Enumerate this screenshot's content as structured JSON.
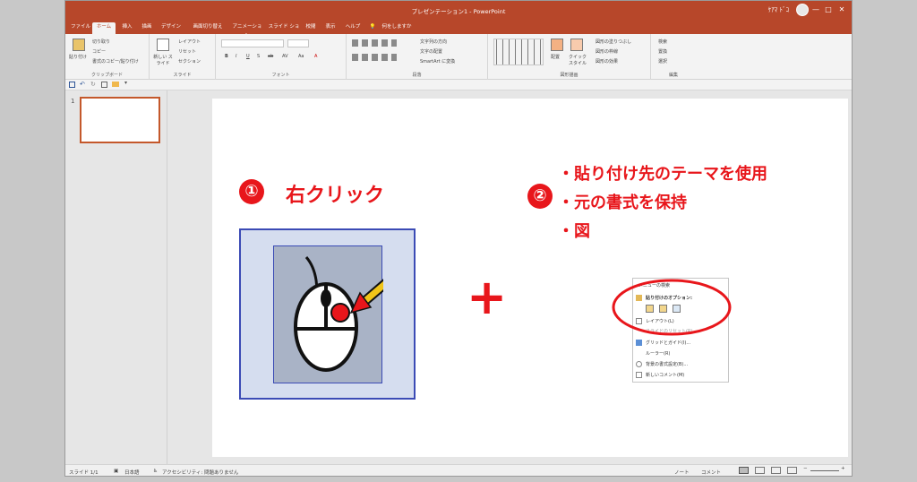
{
  "window": {
    "title": "プレゼンテーション1 - PowerPoint",
    "user": "ｹｱﾏ ﾄﾞｺ",
    "minimize": "—",
    "maximize": "□",
    "close": "✕"
  },
  "tabs": [
    "ファイル",
    "ホーム",
    "挿入",
    "描画",
    "デザイン",
    "画面切り替え",
    "アニメーション",
    "スライド ショー",
    "校閲",
    "表示",
    "ヘルプ",
    "何をしますか"
  ],
  "active_tab": "ホーム",
  "ribbon": {
    "clipboard": {
      "label": "クリップボード",
      "paste": "貼り付け",
      "cut": "切り取り",
      "copy": "コピー",
      "format_painter": "書式のコピー/貼り付け"
    },
    "slides": {
      "label": "スライド",
      "new_slide": "新しい スライド",
      "layout": "レイアウト",
      "reset": "リセット",
      "section": "セクション"
    },
    "font": {
      "label": "フォント",
      "buttons": [
        "B",
        "I",
        "U",
        "S",
        "ab",
        "AV",
        "Aa",
        "A"
      ]
    },
    "paragraph": {
      "label": "段落",
      "text_direction": "文字列の方向",
      "align_text": "文字の配置",
      "smartart": "SmartArt に変換"
    },
    "drawing": {
      "label": "図形描画",
      "arrange": "配置",
      "quick_styles": "クイック スタイル",
      "shape_fill": "図形の塗りつぶし",
      "shape_outline": "図形の枠線",
      "shape_effects": "図形の効果"
    },
    "editing": {
      "label": "編集",
      "find": "検索",
      "replace": "置換",
      "select": "選択"
    }
  },
  "thumbnail": {
    "number": "1"
  },
  "slide": {
    "step1_number": "①",
    "step1_text": "右クリック",
    "plus": "+",
    "step2_number": "②",
    "options": [
      "・貼り付け先のテーマを使用",
      "・元の書式を保持",
      "・図"
    ]
  },
  "context_menu": {
    "items": [
      "メニューの検索",
      "貼り付けのオプション:",
      "レイアウト(L)",
      "スライドのリセット(R)",
      "グリッドとガイド(I)...",
      "ルーラー(R)",
      "背景の書式設定(B)...",
      "新しいコメント(M)"
    ]
  },
  "statusbar": {
    "slide_info": "スライド 1/1",
    "language": "日本語",
    "accessibility": "アクセシビリティ: 問題ありません",
    "notes": "ノート",
    "comments": "コメント"
  },
  "colors": {
    "accent": "#b7472a",
    "annotation_red": "#e8161b",
    "mouse_bg": "#a9b3c6",
    "outer_box": "#d5ddef",
    "outer_border": "#3b4bb5"
  }
}
